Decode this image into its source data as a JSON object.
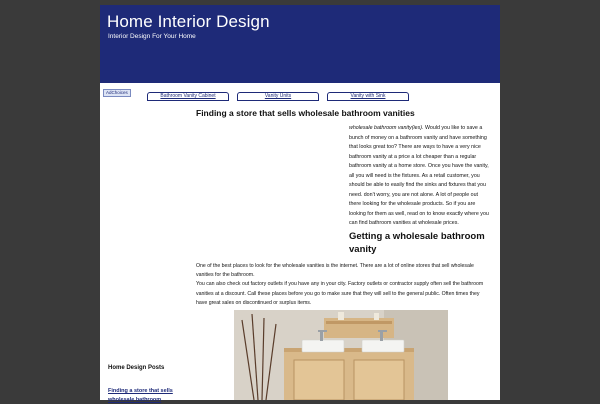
{
  "site": {
    "title": "Home Interior Design",
    "tagline": "Interior Design For Your Home"
  },
  "ads": {
    "adchoices_label": "AdChoices",
    "links": [
      "Bathroom Vanity Cabinet",
      "Vanity Units",
      "Vanity with Sink"
    ]
  },
  "article": {
    "title": "Finding a store that sells wholesale bathroom vanities",
    "intro_lead": "wholesale bathroom vanity(ies).",
    "intro_rest": " Would you like to save a bunch of money on a bathroom vanity and have something that looks great too? There are ways to have a very nice bathroom vanity at a price a lot cheaper than a regular bathroom vanity at a home store. Once you have the vanity, all you will need is the fixtures. As a retail customer, you should be able to easily find the sinks and fixtures that you need. don't worry, you are not alone. A lot of people out there looking for the wholesale products. So if you are looking for them as well, read on to know exactly where you can find bathroom vanities at wholesale prices.",
    "section_heading": "Getting a wholesale bathroom vanity",
    "para1": "One of the best places to look for the wholesale vanities is the internet. There are a lot of online stores that sell wholesale vanities for the bathroom.",
    "para2": "You can also check out factory outlets if you have any in your city. Factory outlets or contractor supply often sell the bathroom vanities at a discount.  Call these places before you go to make sure that they will sell to the general public.  Often times they have great sales on discontinued or surplus items."
  },
  "sidebar": {
    "heading": "Home Design Posts",
    "link": "Finding a store that sells wholesale bathroom"
  },
  "colors": {
    "header_bg": "#1e2a78",
    "page_bg": "#3a3a3a",
    "link": "#1e2a78"
  }
}
